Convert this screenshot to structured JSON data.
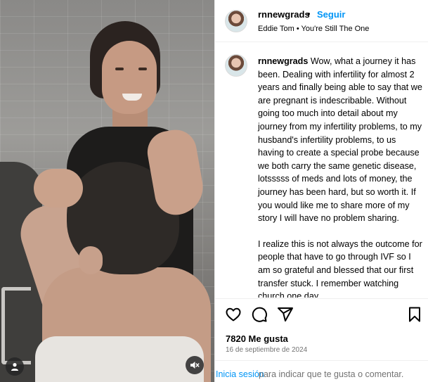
{
  "post": {
    "username": "rnnewgrads",
    "separator": "•",
    "follow_label": "Seguir",
    "audio": "Eddie Tom • You're Still The One"
  },
  "caption": {
    "username": "rnnewgrads",
    "paragraph1": "Wow, what a journey it has been. Dealing with infertility for almost 2 years and finally being able to say that we are pregnant is indescribable. Without going too much into detail about my journey from my infertility problems, to my husband's infertility problems, to us having to create a special probe because we both carry the same genetic disease, lotsssss of meds and lots of money, the journey has been hard, but so worth it. If you would like me to share more of my story I will have no problem sharing.",
    "paragraph2": "I realize this is not always the outcome for people that have to go through IVF so I am so grateful and blessed that our first transfer stuck. I remember watching church one day"
  },
  "engagement": {
    "likes": "7820 Me gusta",
    "date": "16 de septiembre de 2024"
  },
  "login_bar": {
    "link": "Inicia sesión",
    "text": "para indicar que te gusta o comentar."
  },
  "icons": {
    "like": "heart-icon",
    "comment": "comment-icon",
    "share": "share-icon",
    "save": "bookmark-icon",
    "user_tag": "user-icon",
    "mute": "speaker-muted-icon"
  },
  "colors": {
    "link_blue": "#0095f6",
    "secondary_text": "#737373",
    "divider": "#efefef"
  }
}
